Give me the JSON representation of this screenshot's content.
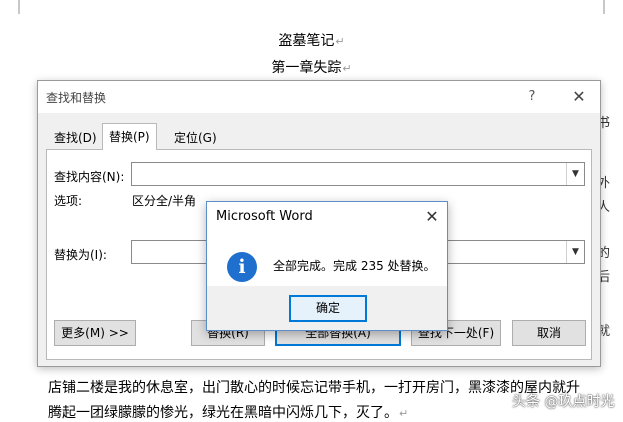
{
  "document": {
    "title": "盗墓笔记",
    "chapter": "第一章失踪",
    "paragraph_mark": "↵",
    "body_line1": "店铺二楼是我的休息室，出门散心的时候忘记带手机，一打开房门，黑漆漆的屋内就升",
    "body_line2": "腾起一团绿朦朦的惨光，绿光在黑暗中闪烁几下，灭了。",
    "right_fragments": [
      "书",
      "外",
      "人",
      "的",
      "后",
      "就"
    ],
    "watermark": "头条 @玖点时光"
  },
  "find_replace_dialog": {
    "title": "查找和替换",
    "help_label": "?",
    "close_label": "✕",
    "tabs": [
      {
        "label": "查找(D)",
        "active": false
      },
      {
        "label": "替换(P)",
        "active": true
      },
      {
        "label": "定位(G)",
        "active": false
      }
    ],
    "find_label": "查找内容(N):",
    "find_value": "",
    "options_label": "选项:",
    "options_value": "区分全/半角",
    "replace_label": "替换为(I):",
    "replace_value": "",
    "buttons": {
      "more": "更多(M) >>",
      "replace": "替换(R)",
      "replace_all": "全部替换(A)",
      "find_next": "查找下一处(F)",
      "cancel": "取消"
    }
  },
  "message_box": {
    "title": "Microsoft Word",
    "close_label": "✕",
    "icon": "info-icon",
    "message": "全部完成。完成 235 处替换。",
    "ok_label": "确定"
  },
  "colors": {
    "accent": "#0078d7",
    "info_icon": "#1f6fcf",
    "dialog_bg": "#f0f0f0"
  }
}
